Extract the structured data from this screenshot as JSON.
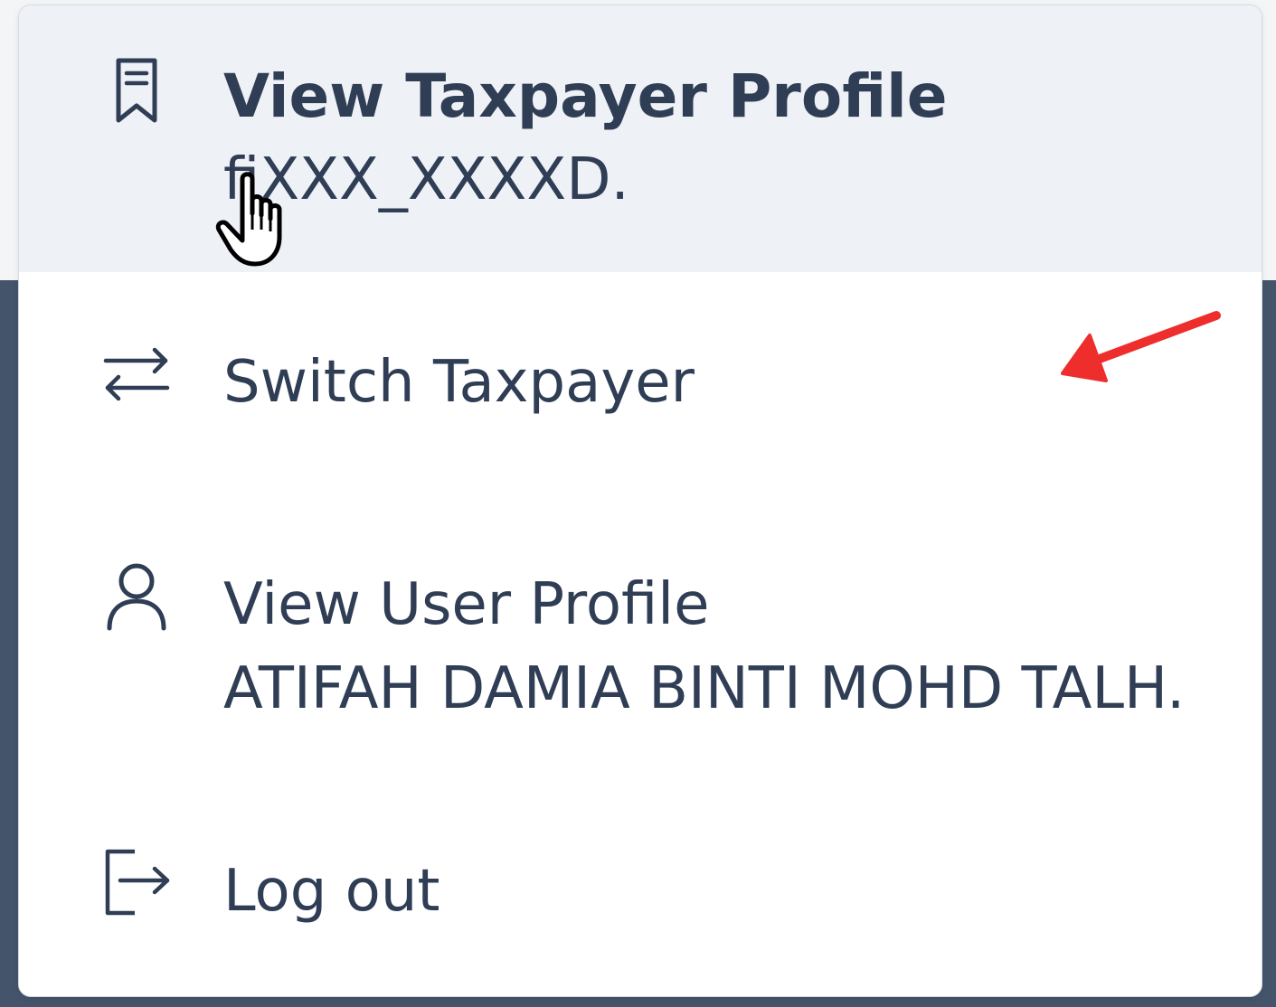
{
  "menu": {
    "items": [
      {
        "icon": "receipt-bookmark-icon",
        "label": "View Taxpayer Profile",
        "sublabel": "fiXXX_XXXXD."
      },
      {
        "icon": "switch-arrows-icon",
        "label": "Switch Taxpayer"
      },
      {
        "icon": "user-icon",
        "label": "View User Profile",
        "sublabel": "ATIFAH DAMIA BINTI MOHD TALH."
      },
      {
        "icon": "logout-icon",
        "label": "Log out"
      }
    ]
  },
  "colors": {
    "text": "#2f3d55",
    "highlight": "#eef1f6",
    "backdrop": "#44546a",
    "annotation": "#ee2d2d"
  },
  "overlay": {
    "cursor_icon": "hand-pointer-icon",
    "annotation_icon": "red-arrow-icon"
  }
}
